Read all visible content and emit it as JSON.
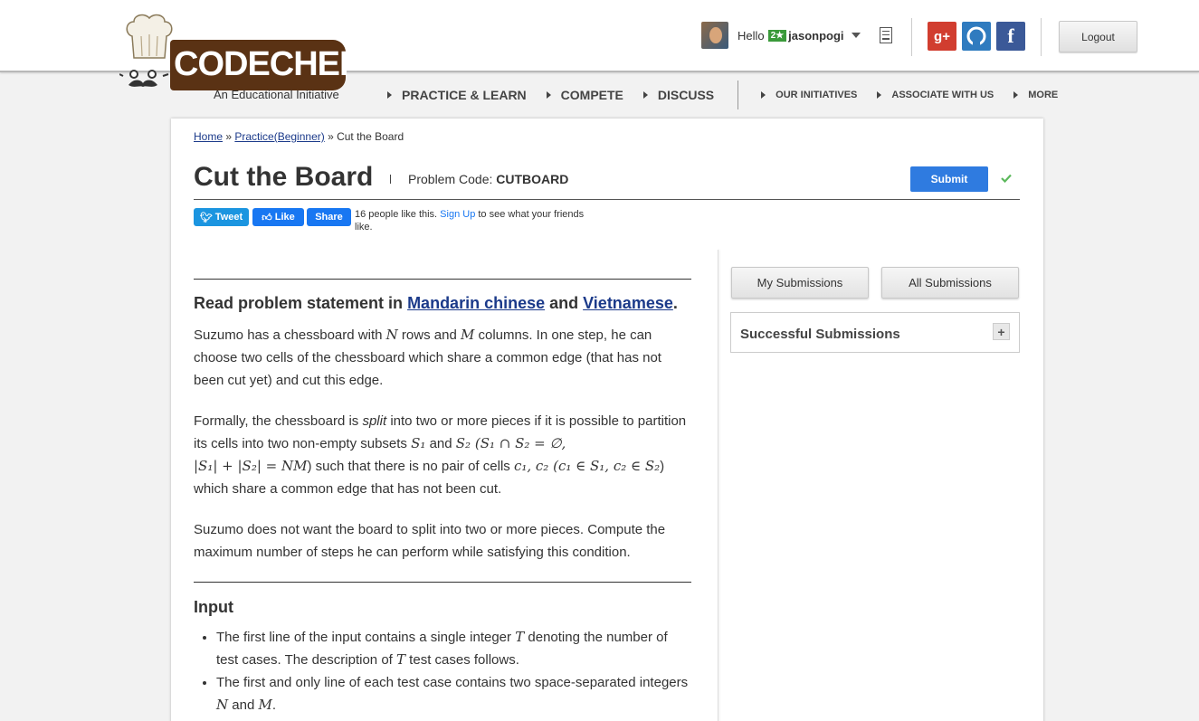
{
  "brand": {
    "logo_text": "CODECHEF",
    "tagline": "An Educational Initiative"
  },
  "user": {
    "hello": "Hello",
    "stars": "2★",
    "username": "jasonpogi"
  },
  "social": {
    "gplus": "g+",
    "facebook": "f"
  },
  "logout_label": "Logout",
  "nav": {
    "practice": "PRACTICE & LEARN",
    "compete": "COMPETE",
    "discuss": "DISCUSS",
    "initiatives": "OUR INITIATIVES",
    "associate": "ASSOCIATE WITH US",
    "more": "MORE"
  },
  "breadcrumb": {
    "home": "Home",
    "sep1": " » ",
    "practice": "Practice(Beginner)",
    "sep2": " » ",
    "current": "Cut the Board"
  },
  "problem": {
    "title": "Cut the Board",
    "code_label": "Problem Code: ",
    "code": "CUTBOARD",
    "submit_label": "Submit"
  },
  "share": {
    "tweet": "Tweet",
    "like": "Like",
    "share": "Share",
    "likes_text": "16 people like this. ",
    "signup": "Sign Up",
    "likes_rest": " to see what your friends like."
  },
  "statement": {
    "read_prefix": "Read problem statement in ",
    "lang1": "Mandarin chinese",
    "and": " and ",
    "lang2": "Vietnamese",
    "period": ".",
    "para1_a": "Suzumo has a chessboard with ",
    "para1_n": "N",
    "para1_b": " rows and ",
    "para1_m": "M",
    "para1_c": " columns. In one step, he can choose two cells of the chessboard which share a common edge (that has not been cut yet) and cut this edge.",
    "para2_a": "Formally, the chessboard is ",
    "para2_split": "split",
    "para2_b": " into two or more pieces if it is possible to partition its cells into two non-empty subsets ",
    "para2_s1": "S₁",
    "para2_c": " and ",
    "para2_s2": "S₂",
    "para2_math1": " (S₁ ∩ S₂ = ∅,",
    "para2_math2": "|S₁| + |S₂| = NM",
    "para2_d": ") such that there is no pair of cells ",
    "para2_math3": "c₁, c₂ (c₁ ∈ S₁, c₂ ∈ S₂",
    "para2_e": ") which share a common edge that has not been cut.",
    "para3": "Suzumo does not want the board to split into two or more pieces. Compute the maximum number of steps he can perform while satisfying this condition."
  },
  "input_section": {
    "heading": "Input",
    "b1_a": "The first line of the input contains a single integer ",
    "b1_t": "T",
    "b1_b": " denoting the number of test cases. The description of ",
    "b1_t2": "T",
    "b1_c": " test cases follows.",
    "b2_a": "The first and only line of each test case contains two space-separated integers ",
    "b2_n": "N",
    "b2_and": " and ",
    "b2_m": "M",
    "b2_end": "."
  },
  "sidebar": {
    "my_submissions": "My Submissions",
    "all_submissions": "All Submissions",
    "successful": "Successful Submissions",
    "expand": "+"
  },
  "colors": {
    "brand_brown": "#5a3214",
    "link": "#1b3a8a",
    "submit_blue": "#2f7be0",
    "success_green": "#5cb85c"
  }
}
